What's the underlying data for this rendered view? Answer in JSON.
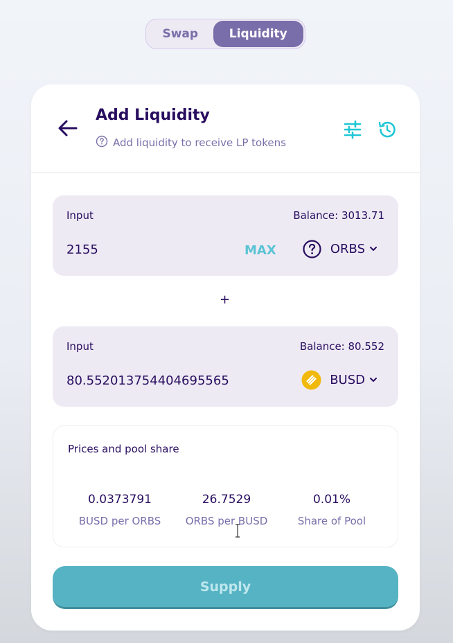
{
  "tabs": {
    "swap": "Swap",
    "liquidity": "Liquidity"
  },
  "header": {
    "title": "Add Liquidity",
    "subtitle": "Add liquidity to receive LP tokens"
  },
  "input_a": {
    "label": "Input",
    "balance": "Balance: 3013.71",
    "value": "2155",
    "max_label": "MAX",
    "token": "ORBS",
    "token_icon": "question-circle-icon"
  },
  "plus_sign": "+",
  "input_b": {
    "label": "Input",
    "balance": "Balance: 80.552",
    "value": "80.552013754404695565",
    "token": "BUSD",
    "token_icon": "busd-coin-icon"
  },
  "prices": {
    "title": "Prices and pool share",
    "items": [
      {
        "value": "0.0373791",
        "label": "BUSD per ORBS"
      },
      {
        "value": "26.7529",
        "label": "ORBS per BUSD"
      },
      {
        "value": "0.01%",
        "label": "Share of Pool"
      }
    ]
  },
  "supply_label": "Supply",
  "colors": {
    "accent_primary": "#7a6eaa",
    "accent_teal": "#1fc7d4",
    "text_dark": "#280d5f",
    "busd_yellow": "#f0b90b"
  }
}
